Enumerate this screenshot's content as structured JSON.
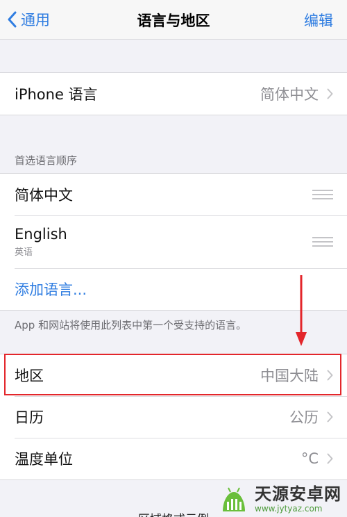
{
  "nav": {
    "back_label": "通用",
    "title": "语言与地区",
    "edit_label": "编辑"
  },
  "iphone_language": {
    "label": "iPhone 语言",
    "value": "简体中文"
  },
  "preferred": {
    "header": "首选语言顺序",
    "languages": [
      {
        "name": "简体中文",
        "subtitle": ""
      },
      {
        "name": "English",
        "subtitle": "英语"
      }
    ],
    "add_label": "添加语言...",
    "footer": "App 和网站将使用此列表中第一个受支持的语言。"
  },
  "region_settings": [
    {
      "label": "地区",
      "value": "中国大陆"
    },
    {
      "label": "日历",
      "value": "公历"
    },
    {
      "label": "温度单位",
      "value": "°C"
    }
  ],
  "bottom_partial": "区域格式示例",
  "colors": {
    "accent": "#2f7de1",
    "annotation": "#e3262b"
  },
  "watermark": {
    "name": "天源安卓网",
    "url": "www.jytyaz.com"
  }
}
